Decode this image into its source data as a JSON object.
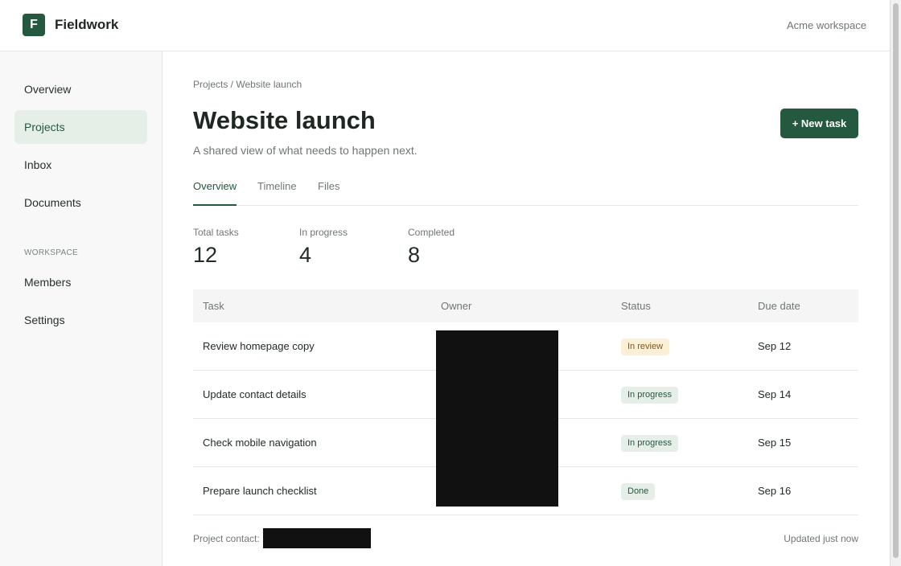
{
  "header": {
    "logo_letter": "F",
    "brand": "Fieldwork",
    "workspace": "Acme workspace"
  },
  "sidebar": {
    "items": [
      {
        "label": "Overview",
        "active": false
      },
      {
        "label": "Projects",
        "active": true
      },
      {
        "label": "Inbox",
        "active": false
      },
      {
        "label": "Documents",
        "active": false
      }
    ],
    "section_label": "WORKSPACE",
    "workspace_items": [
      {
        "label": "Members"
      },
      {
        "label": "Settings"
      }
    ]
  },
  "main": {
    "breadcrumb": "Projects / Website launch",
    "title": "Website launch",
    "subtitle": "A shared view of what needs to happen next.",
    "new_task_label": "+ New task",
    "tabs": [
      {
        "label": "Overview",
        "active": true
      },
      {
        "label": "Timeline",
        "active": false
      },
      {
        "label": "Files",
        "active": false
      }
    ],
    "stats": [
      {
        "label": "Total tasks",
        "value": "12"
      },
      {
        "label": "In progress",
        "value": "4"
      },
      {
        "label": "Completed",
        "value": "8"
      }
    ],
    "table": {
      "columns": [
        "Task",
        "Owner",
        "Status",
        "Due date"
      ],
      "rows": [
        {
          "task": "Review homepage copy",
          "status": "In review",
          "due": "Sep 12"
        },
        {
          "task": "Update contact details",
          "status": "In progress",
          "due": "Sep 14"
        },
        {
          "task": "Check mobile navigation",
          "status": "In progress",
          "due": "Sep 15"
        },
        {
          "task": "Prepare launch checklist",
          "status": "Done",
          "due": "Sep 16"
        }
      ]
    },
    "footer": {
      "contact_label": "Project contact:",
      "updated": "Updated just now"
    }
  },
  "colors": {
    "accent": "#24583f",
    "review_badge_bg": "#fbefd6",
    "progress_badge_bg": "#e5efe8"
  }
}
